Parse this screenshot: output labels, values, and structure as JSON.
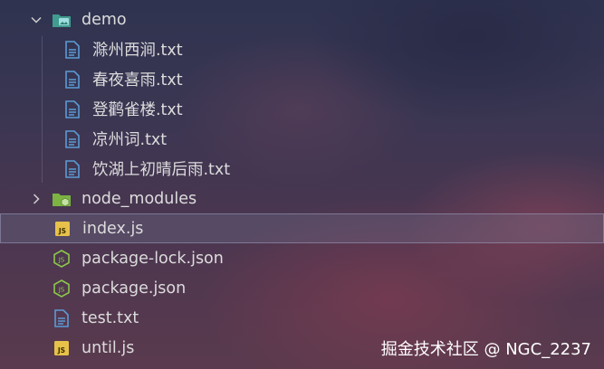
{
  "explorer": {
    "demo_folder": {
      "label": "demo",
      "icon": "folder-image-icon",
      "expanded": true
    },
    "demo_files": [
      {
        "label": "滁州西涧.txt",
        "icon": "text-file-icon"
      },
      {
        "label": "春夜喜雨.txt",
        "icon": "text-file-icon"
      },
      {
        "label": "登鹳雀楼.txt",
        "icon": "text-file-icon"
      },
      {
        "label": "凉州词.txt",
        "icon": "text-file-icon"
      },
      {
        "label": "饮湖上初晴后雨.txt",
        "icon": "text-file-icon"
      }
    ],
    "node_modules": {
      "label": "node_modules",
      "icon": "folder-node-icon",
      "expanded": false
    },
    "root_files": [
      {
        "label": "index.js",
        "icon": "js-file-icon",
        "selected": true
      },
      {
        "label": "package-lock.json",
        "icon": "node-json-icon"
      },
      {
        "label": "package.json",
        "icon": "node-json-icon"
      },
      {
        "label": "test.txt",
        "icon": "text-file-icon"
      },
      {
        "label": "until.js",
        "icon": "js-file-icon"
      }
    ]
  },
  "watermark": "掘金技术社区 @ NGC_2237",
  "colors": {
    "folder_teal": "#4fa69a",
    "folder_green": "#8bc34a",
    "text_file_blue": "#5b9bd5",
    "js_yellow": "#e8c14a",
    "node_green": "#8cc84b"
  }
}
